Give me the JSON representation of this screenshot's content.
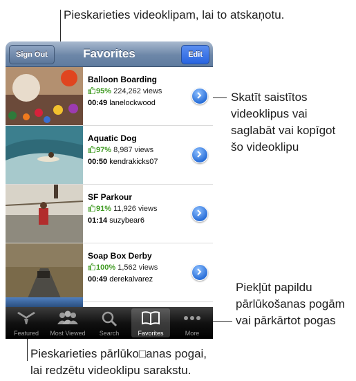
{
  "callouts": {
    "top": "Pieskarieties videoklipam, lai to atskaņotu.",
    "right_lines": [
      "Skatīt saistītos",
      "videoklipus vai",
      "saglabāt vai kopīgot",
      "šo videoklipu"
    ],
    "bottom_right_lines": [
      "Piekļūt papildu",
      "pārlūkošanas pogām",
      "vai pārkārtot pogas"
    ],
    "bottom_lines": [
      "Pieskarieties pārlūko□anas pogai,",
      "lai redzētu videoklipu sarakstu."
    ]
  },
  "nav": {
    "title": "Favorites",
    "left_button": "Sign Out",
    "right_button": "Edit"
  },
  "videos": [
    {
      "title": "Balloon Boarding",
      "rating": "95%",
      "views": "224,262 views",
      "duration": "00:49",
      "user": "lanelockwood"
    },
    {
      "title": "Aquatic Dog",
      "rating": "97%",
      "views": "8,987 views",
      "duration": "00:50",
      "user": "kendrakicks07"
    },
    {
      "title": "SF Parkour",
      "rating": "91%",
      "views": "11,926 views",
      "duration": "01:14",
      "user": "suzybear6"
    },
    {
      "title": "Soap Box Derby",
      "rating": "100%",
      "views": "1,562 views",
      "duration": "00:49",
      "user": "derekalvarez"
    }
  ],
  "tabs": [
    {
      "label": "Featured",
      "icon": "featured-icon"
    },
    {
      "label": "Most Viewed",
      "icon": "most-viewed-icon"
    },
    {
      "label": "Search",
      "icon": "search-icon"
    },
    {
      "label": "Favorites",
      "icon": "favorites-icon",
      "active": true
    },
    {
      "label": "More",
      "icon": "more-icon"
    }
  ],
  "colors": {
    "rating_green": "#3f9a22",
    "nav_blue": "#6d87a8",
    "edit_blue": "#2864e0"
  }
}
